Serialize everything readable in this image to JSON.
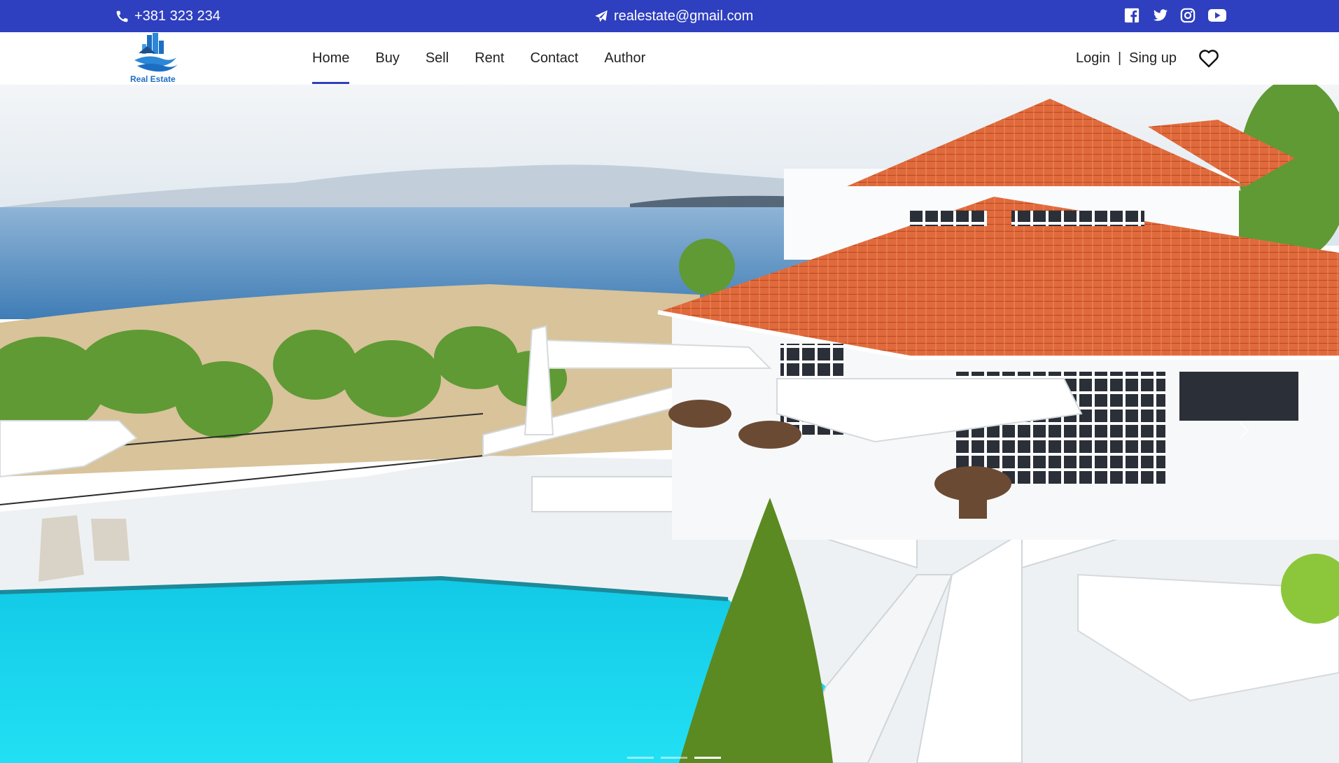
{
  "topbar": {
    "phone": "+381 323 234",
    "email": "realestate@gmail.com",
    "phone_icon": "phone-icon",
    "email_icon": "paper-plane-icon",
    "socials": [
      "facebook-icon",
      "twitter-icon",
      "instagram-icon",
      "youtube-icon"
    ],
    "background": "#2e3fbf"
  },
  "navbar": {
    "logo_text": "Real Estate",
    "links": [
      "Home",
      "Buy",
      "Sell",
      "Rent",
      "Contact",
      "Author"
    ],
    "active": "Home",
    "login": "Login",
    "separator": "|",
    "signup": "Sing up",
    "wishlist_icon": "heart-icon"
  },
  "hero": {
    "slides": 3,
    "active_slide": 3,
    "next_icon": "chevron-right-icon"
  }
}
